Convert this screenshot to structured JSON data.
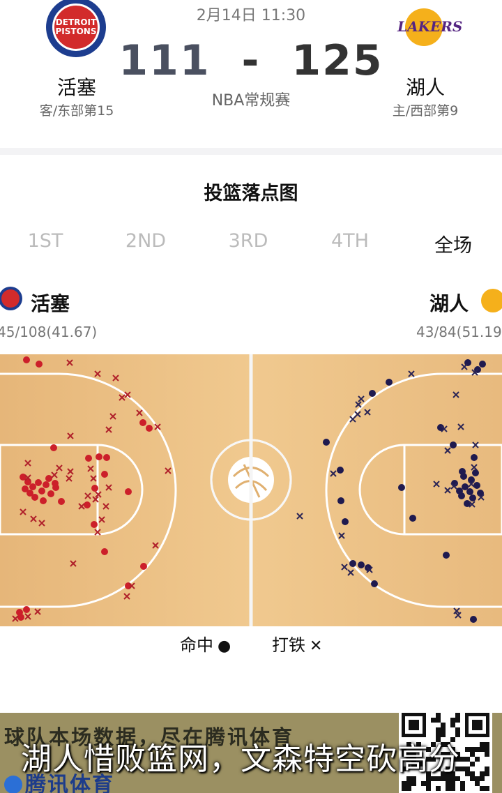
{
  "header": {
    "date_time": "2月14日 11:30",
    "away": {
      "name": "活塞",
      "sub": "客/东部第15",
      "logo_text": "DETROIT\nPISTONS",
      "color": "#d22b2b"
    },
    "home": {
      "name": "湖人",
      "sub": "主/西部第9",
      "logo_text": "LAKERS",
      "color": "#552582"
    },
    "score_away": "111",
    "score_sep": "-",
    "score_home": "125",
    "league": "NBA常规赛"
  },
  "section": {
    "title": "投篮落点图",
    "tabs": [
      "1ST",
      "2ND",
      "3RD",
      "4TH",
      "全场"
    ],
    "active_tab": "全场"
  },
  "shot_chart": {
    "left_team": {
      "name": "活塞",
      "stat": "45/108(41.67)",
      "made_color": "#cc1f2a"
    },
    "right_team": {
      "name": "湖人",
      "stat": "43/84(51.19",
      "made_color": "#1f1a4f"
    },
    "legend": {
      "made_label": "命中",
      "made_symbol": "●",
      "miss_label": "打铁",
      "miss_symbol": "✕"
    }
  },
  "banner": {
    "promo_text": "球队本场数据，尽在腾讯体育",
    "brand": "腾讯体育",
    "caption": "湖人惜败篮网，文森特空砍高分"
  }
}
